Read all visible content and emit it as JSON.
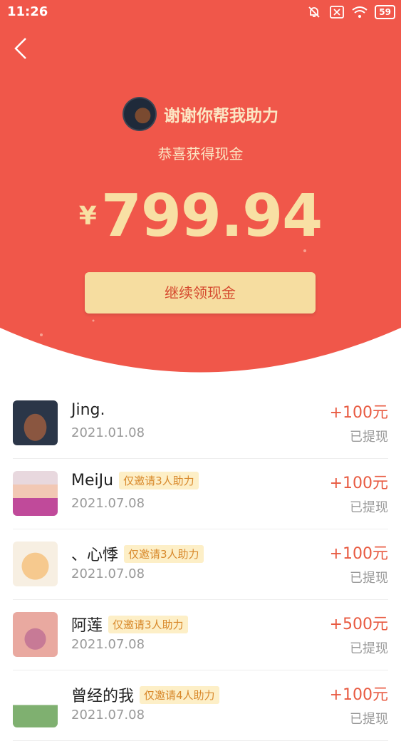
{
  "status_bar": {
    "time": "11:26",
    "battery": "59"
  },
  "header": {
    "title": "谢谢你帮我助力",
    "subtitle": "恭喜获得现金",
    "currency": "¥",
    "amount": "799.94",
    "cta_label": "继续领现金"
  },
  "list": [
    {
      "name": "Jing.",
      "badge": "",
      "date": "2021.01.08",
      "amount": "+100元",
      "status": "已提现"
    },
    {
      "name": "MeiJu",
      "badge": "仅邀请3人助力",
      "date": "2021.07.08",
      "amount": "+100元",
      "status": "已提现"
    },
    {
      "name": "、心悸",
      "badge": "仅邀请3人助力",
      "date": "2021.07.08",
      "amount": "+100元",
      "status": "已提现"
    },
    {
      "name": "阿莲",
      "badge": "仅邀请3人助力",
      "date": "2021.07.08",
      "amount": "+500元",
      "status": "已提现"
    },
    {
      "name": "曾经的我",
      "badge": "仅邀请4人助力",
      "date": "2021.07.08",
      "amount": "+100元",
      "status": "已提现"
    }
  ],
  "colors": {
    "hero": "#f0574a",
    "gold": "#f6dda0",
    "amount_red": "#e85a41"
  }
}
